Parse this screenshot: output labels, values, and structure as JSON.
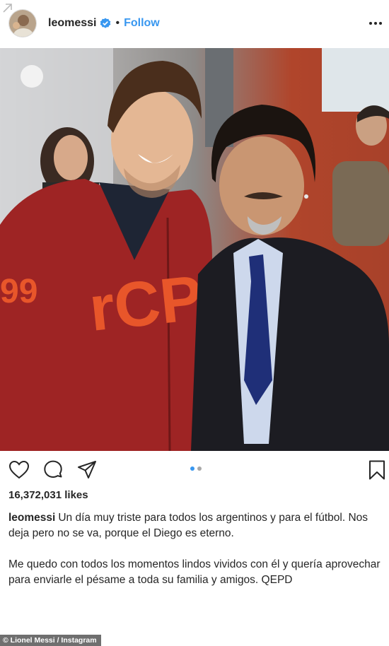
{
  "header": {
    "username": "leomessi",
    "verified": true,
    "separator": "•",
    "follow_label": "Follow",
    "avatar_icon": "profile-avatar",
    "more_icon": "more-options-icon"
  },
  "post": {
    "image_icon": "post-photo",
    "carousel": {
      "count": 2,
      "active": 1
    }
  },
  "actions": {
    "like_icon": "heart-icon",
    "comment_icon": "comment-icon",
    "share_icon": "share-icon",
    "save_icon": "bookmark-icon"
  },
  "likes": "16,372,031 likes",
  "caption": {
    "username": "leomessi",
    "paragraph1": "Un día muy triste para todos los argentinos y para el fútbol. Nos deja pero no se va, porque el Diego es eterno.",
    "paragraph2": "Me quedo con todos los momentos lindos vividos con él y quería aprovechar para enviarle el pésame a toda su familia y amigos. QEPD"
  },
  "credit": "© Lionel Messi / Instagram",
  "colors": {
    "accent": "#3897f0",
    "text": "#262626",
    "jacket": "#9e2424",
    "suit": "#1c1c22"
  }
}
